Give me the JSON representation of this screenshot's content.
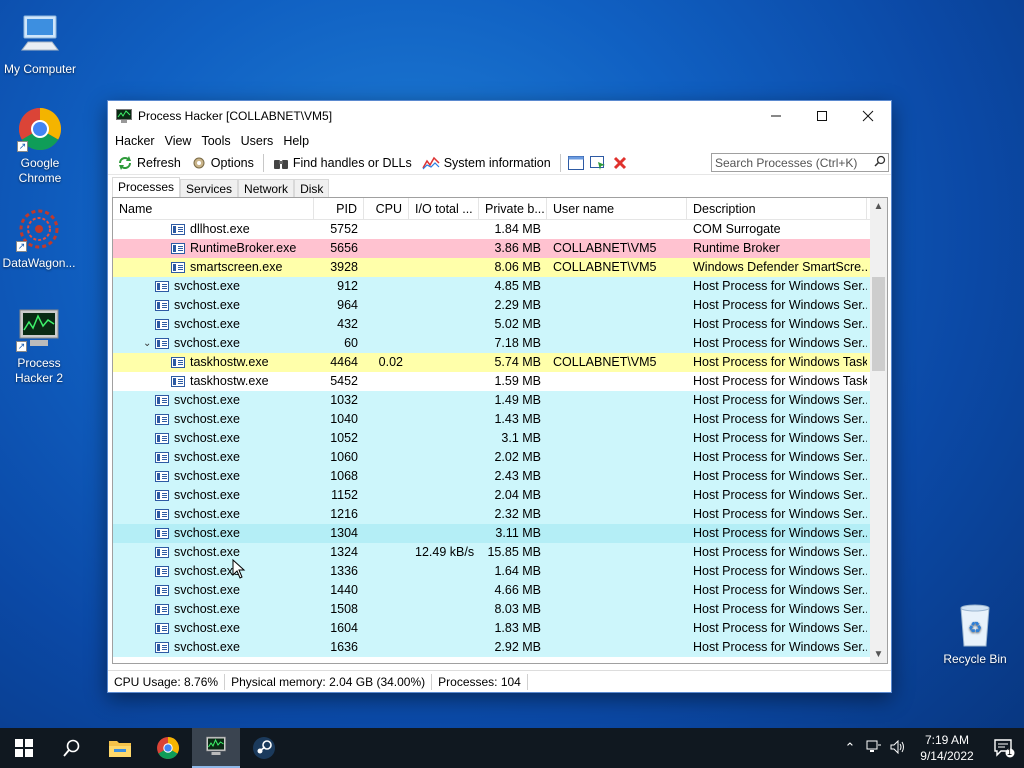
{
  "desktop": {
    "icons": [
      {
        "label": "My Computer",
        "icon": "computer-icon"
      },
      {
        "label": "Google Chrome",
        "icon": "chrome-icon"
      },
      {
        "label": "DataWagon...",
        "icon": "datawagon-icon"
      },
      {
        "label": "Process Hacker 2",
        "icon": "process-hacker-icon"
      },
      {
        "label": "Recycle Bin",
        "icon": "recycle-bin-icon"
      }
    ]
  },
  "window": {
    "title": "Process Hacker [COLLABNET\\VM5]",
    "menu": [
      "Hacker",
      "View",
      "Tools",
      "Users",
      "Help"
    ],
    "toolbar": {
      "refresh": "Refresh",
      "options": "Options",
      "find_handles": "Find handles or DLLs",
      "system_info": "System information"
    },
    "search_placeholder": "Search Processes (Ctrl+K)",
    "tabs": [
      "Processes",
      "Services",
      "Network",
      "Disk"
    ],
    "columns": [
      "Name",
      "PID",
      "CPU",
      "I/O total ...",
      "Private b...",
      "User name",
      "Description"
    ],
    "rows": [
      {
        "name": "dllhost.exe",
        "pid": "5752",
        "cpu": "",
        "io": "",
        "priv": "1.84 MB",
        "user": "",
        "desc": "COM Surrogate",
        "indent": 2,
        "bg": "#ffffff"
      },
      {
        "name": "RuntimeBroker.exe",
        "pid": "5656",
        "cpu": "",
        "io": "",
        "priv": "3.86 MB",
        "user": "COLLABNET\\VM5",
        "desc": "Runtime Broker",
        "indent": 2,
        "bg": "#ffc2d0"
      },
      {
        "name": "smartscreen.exe",
        "pid": "3928",
        "cpu": "",
        "io": "",
        "priv": "8.06 MB",
        "user": "COLLABNET\\VM5",
        "desc": "Windows Defender SmartScre...",
        "indent": 2,
        "bg": "#ffffaa"
      },
      {
        "name": "svchost.exe",
        "pid": "912",
        "cpu": "",
        "io": "",
        "priv": "4.85 MB",
        "user": "",
        "desc": "Host Process for Windows Ser...",
        "indent": 1,
        "bg": "#cdf6fb"
      },
      {
        "name": "svchost.exe",
        "pid": "964",
        "cpu": "",
        "io": "",
        "priv": "2.29 MB",
        "user": "",
        "desc": "Host Process for Windows Ser...",
        "indent": 1,
        "bg": "#cdf6fb"
      },
      {
        "name": "svchost.exe",
        "pid": "432",
        "cpu": "",
        "io": "",
        "priv": "5.02 MB",
        "user": "",
        "desc": "Host Process for Windows Ser...",
        "indent": 1,
        "bg": "#cdf6fb"
      },
      {
        "name": "svchost.exe",
        "pid": "60",
        "cpu": "",
        "io": "",
        "priv": "7.18 MB",
        "user": "",
        "desc": "Host Process for Windows Ser...",
        "indent": 1,
        "bg": "#cdf6fb",
        "expander": "⌄"
      },
      {
        "name": "taskhostw.exe",
        "pid": "4464",
        "cpu": "0.02",
        "io": "",
        "priv": "5.74 MB",
        "user": "COLLABNET\\VM5",
        "desc": "Host Process for Windows Tasks",
        "indent": 2,
        "bg": "#ffffaa"
      },
      {
        "name": "taskhostw.exe",
        "pid": "5452",
        "cpu": "",
        "io": "",
        "priv": "1.59 MB",
        "user": "",
        "desc": "Host Process for Windows Tasks",
        "indent": 2,
        "bg": "#ffffff"
      },
      {
        "name": "svchost.exe",
        "pid": "1032",
        "cpu": "",
        "io": "",
        "priv": "1.49 MB",
        "user": "",
        "desc": "Host Process for Windows Ser...",
        "indent": 1,
        "bg": "#cdf6fb"
      },
      {
        "name": "svchost.exe",
        "pid": "1040",
        "cpu": "",
        "io": "",
        "priv": "1.43 MB",
        "user": "",
        "desc": "Host Process for Windows Ser...",
        "indent": 1,
        "bg": "#cdf6fb"
      },
      {
        "name": "svchost.exe",
        "pid": "1052",
        "cpu": "",
        "io": "",
        "priv": "3.1 MB",
        "user": "",
        "desc": "Host Process for Windows Ser...",
        "indent": 1,
        "bg": "#cdf6fb"
      },
      {
        "name": "svchost.exe",
        "pid": "1060",
        "cpu": "",
        "io": "",
        "priv": "2.02 MB",
        "user": "",
        "desc": "Host Process for Windows Ser...",
        "indent": 1,
        "bg": "#cdf6fb"
      },
      {
        "name": "svchost.exe",
        "pid": "1068",
        "cpu": "",
        "io": "",
        "priv": "2.43 MB",
        "user": "",
        "desc": "Host Process for Windows Ser...",
        "indent": 1,
        "bg": "#cdf6fb"
      },
      {
        "name": "svchost.exe",
        "pid": "1152",
        "cpu": "",
        "io": "",
        "priv": "2.04 MB",
        "user": "",
        "desc": "Host Process for Windows Ser...",
        "indent": 1,
        "bg": "#cdf6fb"
      },
      {
        "name": "svchost.exe",
        "pid": "1216",
        "cpu": "",
        "io": "",
        "priv": "2.32 MB",
        "user": "",
        "desc": "Host Process for Windows Ser...",
        "indent": 1,
        "bg": "#cdf6fb"
      },
      {
        "name": "svchost.exe",
        "pid": "1304",
        "cpu": "",
        "io": "",
        "priv": "3.11 MB",
        "user": "",
        "desc": "Host Process for Windows Ser...",
        "indent": 1,
        "bg": "#b4eef6"
      },
      {
        "name": "svchost.exe",
        "pid": "1324",
        "cpu": "",
        "io": "12.49 kB/s",
        "priv": "15.85 MB",
        "user": "",
        "desc": "Host Process for Windows Ser...",
        "indent": 1,
        "bg": "#cdf6fb"
      },
      {
        "name": "svchost.exe",
        "pid": "1336",
        "cpu": "",
        "io": "",
        "priv": "1.64 MB",
        "user": "",
        "desc": "Host Process for Windows Ser...",
        "indent": 1,
        "bg": "#cdf6fb"
      },
      {
        "name": "svchost.exe",
        "pid": "1440",
        "cpu": "",
        "io": "",
        "priv": "4.66 MB",
        "user": "",
        "desc": "Host Process for Windows Ser...",
        "indent": 1,
        "bg": "#cdf6fb"
      },
      {
        "name": "svchost.exe",
        "pid": "1508",
        "cpu": "",
        "io": "",
        "priv": "8.03 MB",
        "user": "",
        "desc": "Host Process for Windows Ser...",
        "indent": 1,
        "bg": "#cdf6fb"
      },
      {
        "name": "svchost.exe",
        "pid": "1604",
        "cpu": "",
        "io": "",
        "priv": "1.83 MB",
        "user": "",
        "desc": "Host Process for Windows Ser...",
        "indent": 1,
        "bg": "#cdf6fb"
      },
      {
        "name": "svchost.exe",
        "pid": "1636",
        "cpu": "",
        "io": "",
        "priv": "2.92 MB",
        "user": "",
        "desc": "Host Process for Windows Ser...",
        "indent": 1,
        "bg": "#cdf6fb"
      }
    ],
    "status": {
      "cpu": "CPU Usage: 8.76%",
      "memory": "Physical memory: 2.04 GB (34.00%)",
      "processes": "Processes: 104"
    }
  },
  "taskbar": {
    "apps": [
      "start-icon",
      "search-icon",
      "file-explorer-icon",
      "chrome-icon",
      "process-hacker-icon",
      "steam-icon"
    ],
    "active_app": "process-hacker-icon",
    "clock_time": "7:19 AM",
    "clock_date": "9/14/2022",
    "notification_count": "1"
  }
}
